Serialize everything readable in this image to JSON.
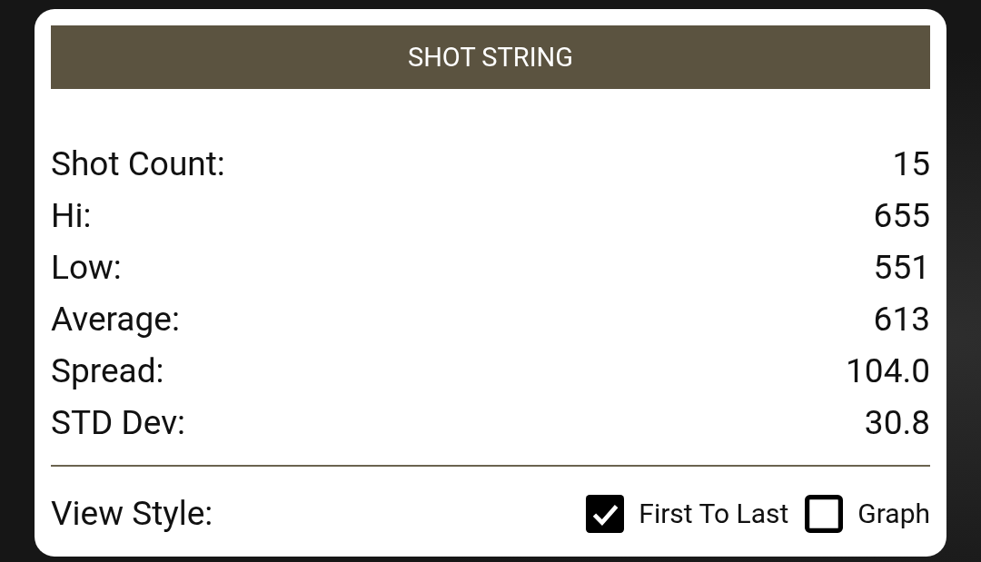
{
  "header": {
    "title": "SHOT STRING"
  },
  "stats": [
    {
      "label": "Shot Count:",
      "value": "15"
    },
    {
      "label": "Hi:",
      "value": "655"
    },
    {
      "label": "Low:",
      "value": "551"
    },
    {
      "label": "Average:",
      "value": "613"
    },
    {
      "label": "Spread:",
      "value": "104.0"
    },
    {
      "label": "STD Dev:",
      "value": "30.8"
    }
  ],
  "view_style": {
    "label": "View Style:",
    "options": [
      {
        "label": "First To Last",
        "checked": true
      },
      {
        "label": "Graph",
        "checked": false
      }
    ]
  }
}
